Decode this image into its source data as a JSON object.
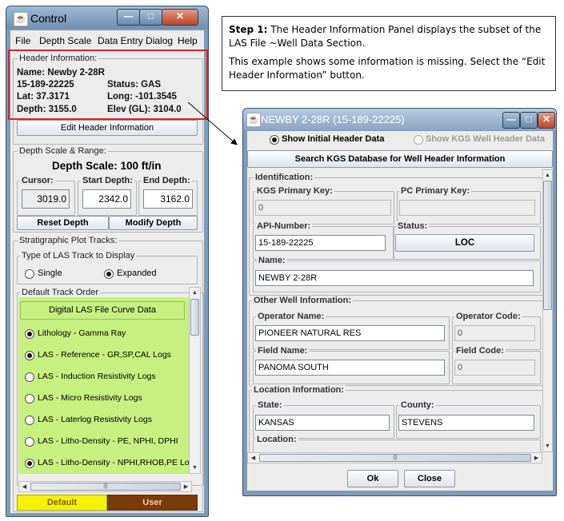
{
  "control": {
    "title": "Control",
    "menu": [
      "File",
      "Depth Scale",
      "Data Entry Dialog",
      "Help"
    ],
    "header_info": {
      "label": "Header Information:",
      "well_name": "Name: Newby 2-28R",
      "api": "15-189-22225",
      "status": "Status: GAS",
      "lat": "Lat: 37.3171",
      "long": "Long: -101.3545",
      "depth": "Depth: 3155.0",
      "elev": "Elev (GL): 3104.0",
      "edit_button": "Edit Header Information"
    },
    "depth_scale": {
      "label": "Depth Scale & Range:",
      "scale": "Depth Scale: 100 ft/in",
      "cursor_label": "Cursor:",
      "cursor_value": "3019.0",
      "start_label": "Start Depth:",
      "start_value": "2342.0",
      "end_label": "End Depth:",
      "end_value": "3162.0",
      "reset_button": "Reset Depth",
      "modify_button": "Modify Depth"
    },
    "strat": {
      "label": "Stratigraphic Plot Tracks:",
      "type_label": "Type of LAS Track to Display",
      "single": "Single",
      "expanded": "Expanded",
      "selected": "Expanded"
    },
    "track_order": {
      "label": "Default Track Order",
      "header_button": "Digital LAS File Curve Data",
      "items": [
        {
          "label": "Lithology - Gamma Ray",
          "checked": true
        },
        {
          "label": "LAS - Reference - GR,SP,CAL Logs",
          "checked": true
        },
        {
          "label": "LAS - Induction Resistivity Logs",
          "checked": false
        },
        {
          "label": "LAS - Micro Resistivity Logs",
          "checked": false
        },
        {
          "label": "LAS - Laterlog Resistivity Logs",
          "checked": false
        },
        {
          "label": "LAS - Litho-Density - PE, NPHI, DPHI",
          "checked": false
        },
        {
          "label": "LAS - Litho-Density - NPHI,RHOB,PE Logs",
          "checked": true
        }
      ],
      "hscroll_mark": "|||"
    },
    "bottom": {
      "default_label": "Default",
      "user_label": "User",
      "default_color": "#f4f400",
      "user_color": "#7a3b06"
    }
  },
  "callout": {
    "step_label": "Step 1:",
    "line1": " The Header Information Panel displays the subset of the LAS File ~Well Data Section.",
    "line2": "This example shows some information is missing.  Select the “Edit Header Information” button."
  },
  "newby": {
    "title": "NEWBY 2-28R (15-189-22225)",
    "radio_initial": "Show Initial Header Data",
    "radio_kgs": "Show KGS Well Header Data",
    "search_button": "Search KGS Database for Well Header Information",
    "identification": {
      "label": "Identification:",
      "kgs_key_label": "KGS Primary Key:",
      "kgs_key_value": "0",
      "pc_key_label": "PC Primary Key:",
      "pc_key_value": "",
      "api_label": "API-Number:",
      "api_value": "15-189-22225",
      "status_label": "Status:",
      "status_value": "LOC",
      "name_label": "Name:",
      "name_value": "NEWBY 2-28R"
    },
    "other": {
      "label": "Other Well Information:",
      "operator_name_label": "Operator Name:",
      "operator_name_value": "PIONEER NATURAL RES",
      "operator_code_label": "Operator Code:",
      "operator_code_value": "0",
      "field_name_label": "Field Name:",
      "field_name_value": "PANOMA SOUTH",
      "field_code_label": "Field Code:",
      "field_code_value": "0"
    },
    "location": {
      "label": "Location Information:",
      "state_label": "State:",
      "state_value": "KANSAS",
      "county_label": "County:",
      "county_value": "STEVENS",
      "location_label": "Location:"
    },
    "hscroll_mark": "|||",
    "ok_button": "Ok",
    "close_button": "Close"
  }
}
